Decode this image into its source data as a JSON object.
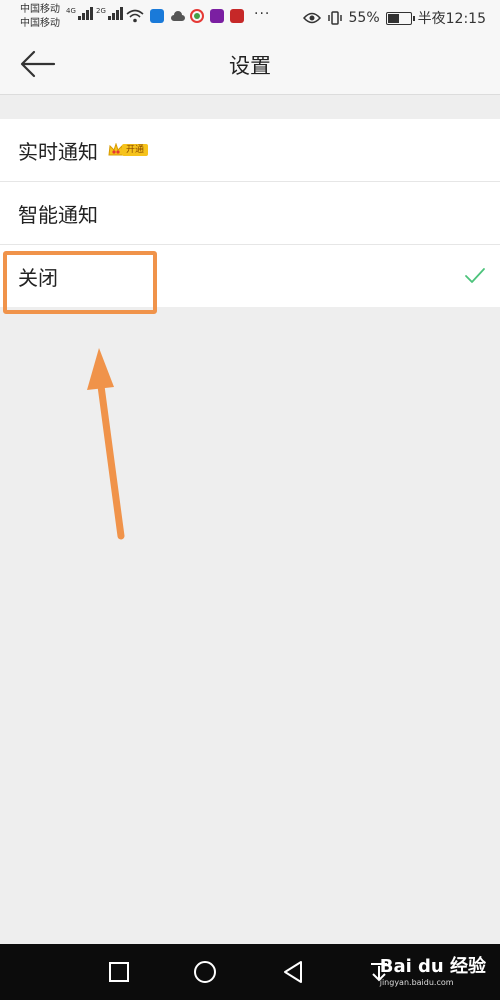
{
  "status_bar": {
    "carrier1": "中国移动",
    "carrier2": "中国移动",
    "net1": "4G",
    "net2": "2G",
    "battery_percent": "55%",
    "battery_level": 0.55,
    "time": "半夜12:15",
    "overflow": "···"
  },
  "header": {
    "title": "设置",
    "back_icon": "arrow-left-icon"
  },
  "settings_list": {
    "items": [
      {
        "label": "实时通知",
        "badge": "开通",
        "selected": false
      },
      {
        "label": "智能通知",
        "selected": false
      },
      {
        "label": "关闭",
        "selected": true
      }
    ]
  },
  "navbar": {
    "icons": [
      "square-icon",
      "circle-icon",
      "triangle-back-icon",
      "download-icon"
    ]
  },
  "watermark": {
    "brand": "Bai du 经验",
    "url": "jingyan.baidu.com"
  },
  "colors": {
    "accent_check": "#4cc37b",
    "annotation": "#f0934a",
    "vip_badge": "#f6c31c"
  }
}
